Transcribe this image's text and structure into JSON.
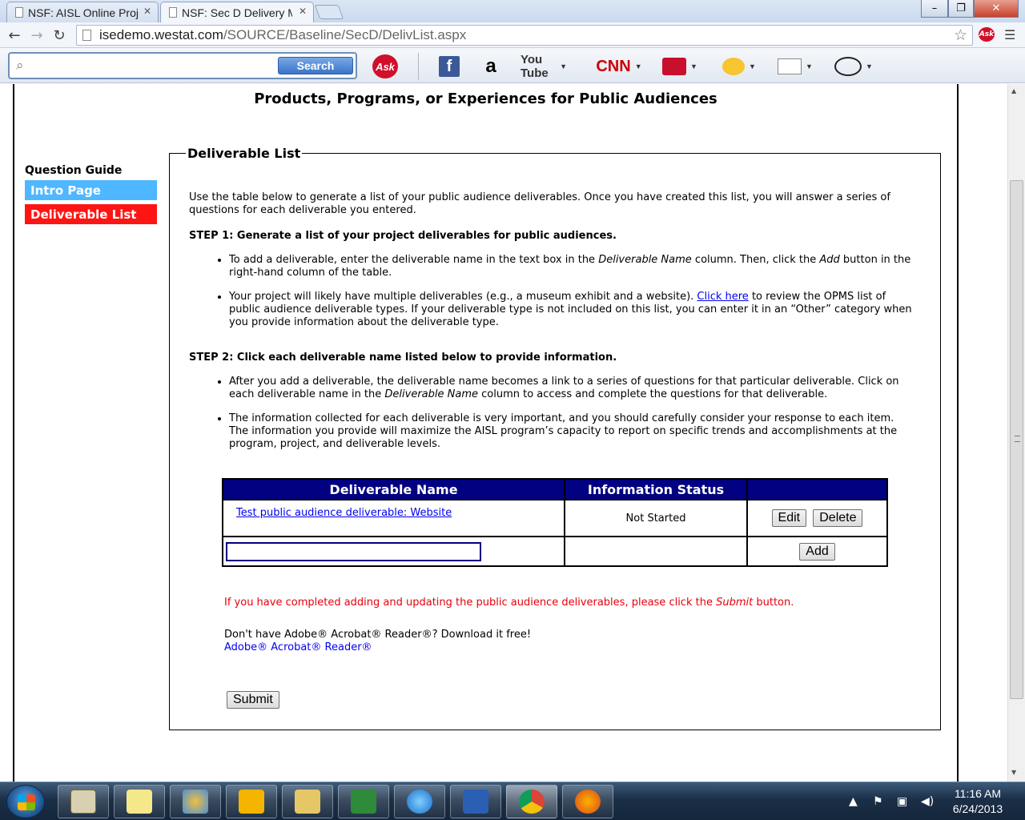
{
  "browser": {
    "tabs": [
      {
        "title": "NSF: AISL Online Proj",
        "active": false
      },
      {
        "title": "NSF: Sec D Delivery M",
        "active": true
      }
    ],
    "url_host": "isedemo.westat.com",
    "url_path": "/SOURCE/Baseline/SecD/DelivList.aspx",
    "window_controls": {
      "minimize": "–",
      "maximize": "❐",
      "close": "✕"
    }
  },
  "toolbar": {
    "search_button": "Search",
    "search_value": "",
    "items": [
      "ask-logo",
      "facebook",
      "amazon",
      "youtube",
      "cnn",
      "games",
      "weather",
      "mail",
      "dictionary"
    ],
    "ask_label": "Ask",
    "facebook_label": "f",
    "amazon_label": "a",
    "youtube_label": "You Tube",
    "cnn_label": "CNN"
  },
  "page": {
    "title": "Products, Programs, or Experiences for Public Audiences",
    "question_guide": {
      "title": "Question Guide",
      "items": [
        "Intro Page",
        "Deliverable List"
      ]
    },
    "section_legend": "Deliverable List",
    "intro": "Use the table below to generate a list of your public audience deliverables. Once you have created this list, you will answer a series of questions for each deliverable you entered.",
    "step1_title": "STEP 1: Generate a list of your project deliverables for public audiences.",
    "step1_b1_a": "To add a deliverable, enter the deliverable name in the text box in the ",
    "step1_b1_em1": "Deliverable Name",
    "step1_b1_b": " column. Then, click the ",
    "step1_b1_em2": "Add",
    "step1_b1_c": " button in the right-hand column of the table.",
    "step1_b2_a": "Your project will likely have multiple deliverables (e.g., a museum exhibit and a website). ",
    "step1_b2_link": "Click here",
    "step1_b2_b": " to review the OPMS list of public audience deliverable types. If your deliverable type is not included on this list, you can enter it in an “Other” category when you provide information about the deliverable type.",
    "step2_title": "STEP 2: Click each deliverable name listed below to provide information.",
    "step2_b1_a": "After you add a deliverable, the deliverable name becomes a link to a series of questions for that particular deliverable. Click on each deliverable name in the ",
    "step2_b1_em": "Deliverable Name",
    "step2_b1_b": " column to access and complete the questions for that deliverable.",
    "step2_b2": "The information collected for each deliverable is very important, and you should carefully consider your response to each item. The information you provide will maximize the AISL program’s capacity to report on specific trends and accomplishments at the program, project, and deliverable levels.",
    "table": {
      "headers": [
        "Deliverable Name",
        "Information Status",
        ""
      ],
      "rows": [
        {
          "name": "Test public audience deliverable: Website",
          "status": "Not Started",
          "edit": "Edit",
          "delete": "Delete"
        }
      ],
      "new_name_value": "",
      "add_label": "Add"
    },
    "submit_note_a": "If you have completed adding and updating the public audience deliverables, please click the ",
    "submit_note_em": "Submit",
    "submit_note_b": " button.",
    "adobe_text": "Don't have Adobe® Acrobat® Reader®? Download it free!",
    "adobe_link": "Adobe® Acrobat® Reader®",
    "submit_label": "Submit"
  },
  "taskbar": {
    "apps": [
      "task-manager",
      "sticky-notes",
      "paint",
      "outlook",
      "file-explorer",
      "excel",
      "internet-explorer",
      "word",
      "chrome",
      "firefox"
    ],
    "time": "11:16 AM",
    "date": "6/24/2013"
  },
  "colors": {
    "table_header": "#000080",
    "intro_btn": "#4fb7ff",
    "deliv_btn": "#ff1414",
    "note_red": "#e8000b",
    "link": "#0000ee"
  }
}
